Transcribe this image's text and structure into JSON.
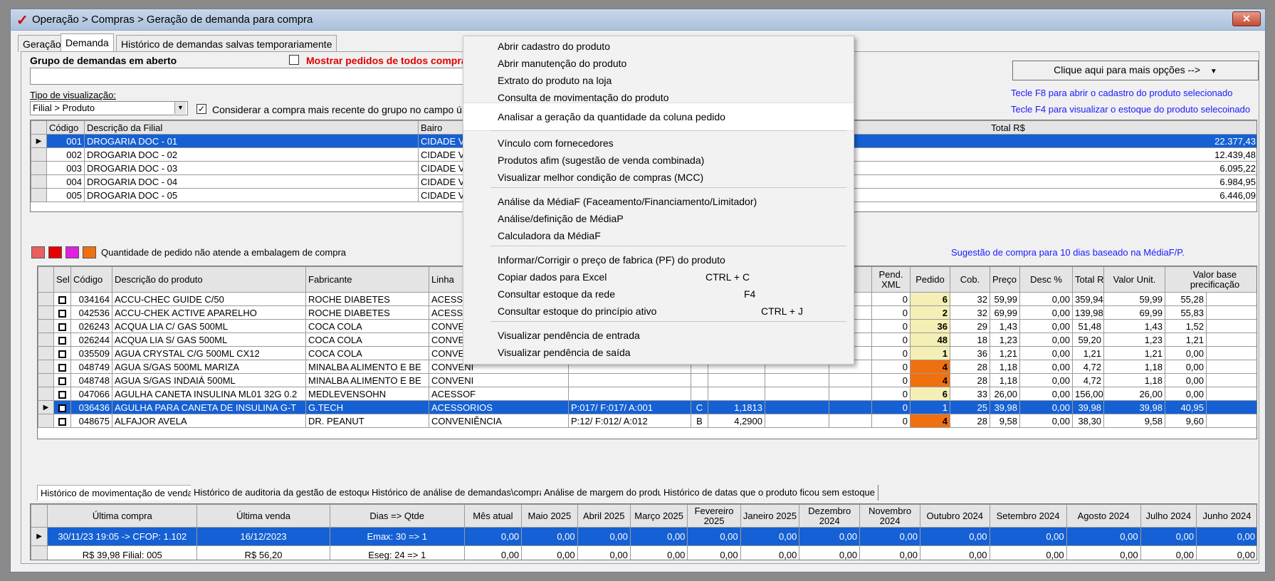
{
  "window": {
    "title": "Operação > Compras > Geração de demanda para compra",
    "close_icon": "close-icon"
  },
  "tabs": [
    "Geração",
    "Demanda",
    "Histórico de demandas salvas temporariamente"
  ],
  "group": {
    "label": "Grupo de demandas em aberto",
    "show_all_label": "Mostrar pedidos de todos compra",
    "view_type_label": "Tipo de visualização:",
    "view_type_value": "Filial > Produto",
    "consider_label": "Considerar a compra mais recente do grupo no campo última c"
  },
  "right_panel": {
    "more_options": "Clique aqui para mais opções -->",
    "hint_f8": "Tecle F8 para abrir o cadastro do produto selecionado",
    "hint_f4": "Tecle F4 para visualizar o estoque do produto selecoinado",
    "suggestion": "Sugestão de compra para 10 dias baseado na MédiaF/P."
  },
  "branch_table": {
    "headers": [
      "Código",
      "Descrição da Filial",
      "Bairo",
      "Total R$"
    ],
    "rows": [
      {
        "code": "001",
        "desc": "DROGARIA DOC - 01",
        "bairro": "CIDADE VI",
        "total": "22.377,43",
        "selected": true
      },
      {
        "code": "002",
        "desc": "DROGARIA DOC - 02",
        "bairro": "CIDADE VI",
        "total": "12.439,48"
      },
      {
        "code": "003",
        "desc": "DROGARIA DOC - 03",
        "bairro": "CIDADE VI",
        "total": "6.095,22"
      },
      {
        "code": "004",
        "desc": "DROGARIA DOC - 04",
        "bairro": "CIDADE VI",
        "total": "6.984,95"
      },
      {
        "code": "005",
        "desc": "DROGARIA DOC - 05",
        "bairro": "CIDADE VI",
        "total": "6.446,09"
      }
    ]
  },
  "legend": {
    "text": "Quantidade de pedido não atende a embalagem de compra",
    "colors": [
      "#e86060",
      "#e80000",
      "#e020e0",
      "#f07010"
    ]
  },
  "product_table": {
    "headers": [
      "Sel",
      "Código",
      "Descrição do produto",
      "Fabricante",
      "Linha",
      "Pend. XML",
      "Pedido",
      "Cob.",
      "Preço R$",
      "Desc %",
      "Total R$",
      "Valor Unit.",
      "Valor base precificação"
    ],
    "rows": [
      {
        "code": "034164",
        "desc": "ACCU-CHEC GUIDE C/50",
        "fab": "ROCHE DIABETES",
        "linha": "ACESSOF",
        "pend": "0",
        "pedido": "6",
        "cob": "32",
        "preco": "59,99",
        "desc_pct": "0,00",
        "total": "359,94",
        "unit": "59,99",
        "base": "55,28",
        "ped_color": "yellow"
      },
      {
        "code": "042536",
        "desc": "ACCU-CHEK ACTIVE APARELHO",
        "fab": "ROCHE DIABETES",
        "linha": "ACESSOF",
        "pend": "0",
        "pedido": "2",
        "cob": "32",
        "preco": "69,99",
        "desc_pct": "0,00",
        "total": "139,98",
        "unit": "69,99",
        "base": "55,83",
        "ped_color": "yellow"
      },
      {
        "code": "026243",
        "desc": "ACQUA LIA C/ GAS 500ML",
        "fab": "COCA COLA",
        "linha": "CONVENI",
        "pend": "0",
        "pedido": "36",
        "cob": "29",
        "preco": "1,43",
        "desc_pct": "0,00",
        "total": "51,48",
        "unit": "1,43",
        "base": "1,52",
        "ped_color": "yellow"
      },
      {
        "code": "026244",
        "desc": "ACQUA LIA S/ GAS 500ML",
        "fab": "COCA COLA",
        "linha": "CONVENI",
        "pend": "0",
        "pedido": "48",
        "cob": "18",
        "preco": "1,23",
        "desc_pct": "0,00",
        "total": "59,20",
        "unit": "1,23",
        "base": "1,21",
        "ped_color": "yellow"
      },
      {
        "code": "035509",
        "desc": "AGUA CRYSTAL C/G 500ML CX12",
        "fab": "COCA COLA",
        "linha": "CONVENI",
        "pend": "0",
        "pedido": "1",
        "cob": "36",
        "preco": "1,21",
        "desc_pct": "0,00",
        "total": "1,21",
        "unit": "1,21",
        "base": "0,00",
        "ped_color": "yellow"
      },
      {
        "code": "048749",
        "desc": "AGUA S/GAS 500ML MARIZA",
        "fab": "MINALBA ALIMENTO E BE",
        "linha": "CONVENI",
        "pend": "0",
        "pedido": "4",
        "cob": "28",
        "preco": "1,18",
        "desc_pct": "0,00",
        "total": "4,72",
        "unit": "1,18",
        "base": "0,00",
        "ped_color": "orange"
      },
      {
        "code": "048748",
        "desc": "AGUA S/GAS INDAIÁ 500ML",
        "fab": "MINALBA ALIMENTO E BE",
        "linha": "CONVENI",
        "pend": "0",
        "pedido": "4",
        "cob": "28",
        "preco": "1,18",
        "desc_pct": "0,00",
        "total": "4,72",
        "unit": "1,18",
        "base": "0,00",
        "ped_color": "orange"
      },
      {
        "code": "047066",
        "desc": "AGULHA CANETA INSULINA ML01 32G 0.2",
        "fab": "MEDLEVENSOHN",
        "linha": "ACESSOF",
        "pend": "0",
        "pedido": "6",
        "cob": "33",
        "preco": "26,00",
        "desc_pct": "0,00",
        "total": "156,00",
        "unit": "26,00",
        "base": "0,00",
        "ped_color": "yellow"
      },
      {
        "code": "036436",
        "desc": "AGULHA PARA CANETA DE INSULINA G-T",
        "fab": "G.TECH",
        "linha": "ACESSORIOS",
        "extra1": "P:017/ F:017/ A:001",
        "extra2": "C",
        "extra3": "1,1813",
        "pend": "0",
        "pedido": "1",
        "cob": "25",
        "preco": "39,98",
        "desc_pct": "0,00",
        "total": "39,98",
        "unit": "39,98",
        "base": "40,95",
        "selected": true
      },
      {
        "code": "048675",
        "desc": "ALFAJOR AVELA",
        "fab": "DR. PEANUT",
        "linha": "CONVENIÊNCIA",
        "extra1": "P:12/ F:012/ A:012",
        "extra2": "B",
        "extra3": "4,2900",
        "pend": "0",
        "pedido": "4",
        "cob": "28",
        "preco": "9,58",
        "desc_pct": "0,00",
        "total": "38,30",
        "unit": "9,58",
        "base": "9,60",
        "ped_color": "orange"
      }
    ]
  },
  "bottom_tabs": [
    "Histórico de movimentação de vendas",
    "Histórico de auditoria da gestão de estoque",
    "Histórico de análise de demandas\\compras",
    "Análise de margem do produto",
    "Histórico de datas que o produto ficou sem estoque"
  ],
  "history_table": {
    "headers": [
      "Última compra",
      "Última venda",
      "Dias => Qtde",
      "Mês atual",
      "Maio 2025",
      "Abril 2025",
      "Março 2025",
      "Fevereiro 2025",
      "Janeiro 2025",
      "Dezembro 2024",
      "Novembro 2024",
      "Outubro 2024",
      "Setembro 2024",
      "Agosto 2024",
      "Julho 2024",
      "Junho 2024"
    ],
    "rows": [
      {
        "cells": [
          "30/11/23 19:05 -> CFOP: 1.102",
          "16/12/2023",
          "Emax: 30 => 1",
          "0,00",
          "0,00",
          "0,00",
          "0,00",
          "0,00",
          "0,00",
          "0,00",
          "0,00",
          "0,00",
          "0,00",
          "0,00",
          "0,00",
          "0,00"
        ],
        "selected": true
      },
      {
        "cells": [
          "R$ 39,98 Filial: 005",
          "R$ 56,20",
          "Eseg: 24 => 1",
          "0,00",
          "0,00",
          "0,00",
          "0,00",
          "0,00",
          "0,00",
          "0,00",
          "0,00",
          "0,00",
          "0,00",
          "0,00",
          "0,00",
          "0,00"
        ]
      }
    ]
  },
  "context_menu": {
    "items": [
      {
        "label": "Abrir cadastro do produto"
      },
      {
        "label": "Abrir manutenção do produto"
      },
      {
        "label": "Extrato do produto na loja"
      },
      {
        "label": "Consulta de movimentação do produto"
      },
      {
        "label": "Analisar a geração da quantidade da coluna pedido",
        "highlight": true
      },
      {
        "label": "Vínculo com fornecedores"
      },
      {
        "label": "Produtos afim (sugestão de venda combinada)"
      },
      {
        "label": "Visualizar melhor condição de compras (MCC)"
      },
      {
        "label": "Análise da MédiaF (Faceamento/Financiamento/Limitador)"
      },
      {
        "label": "Análise/definição de MédiaP"
      },
      {
        "label": "Calculadora da MédiaF"
      },
      {
        "label": "Informar/Corrigir o preço de fabrica (PF) do produto"
      },
      {
        "label": "Copiar dados para Excel",
        "shortcut": "CTRL + C"
      },
      {
        "label": "Consultar estoque da rede",
        "shortcut": "F4"
      },
      {
        "label": "Consultar estoque do princípio ativo",
        "shortcut": "CTRL + J"
      },
      {
        "label": "Visualizar pendência de entrada"
      },
      {
        "label": "Visualizar pendência de saída"
      }
    ]
  }
}
